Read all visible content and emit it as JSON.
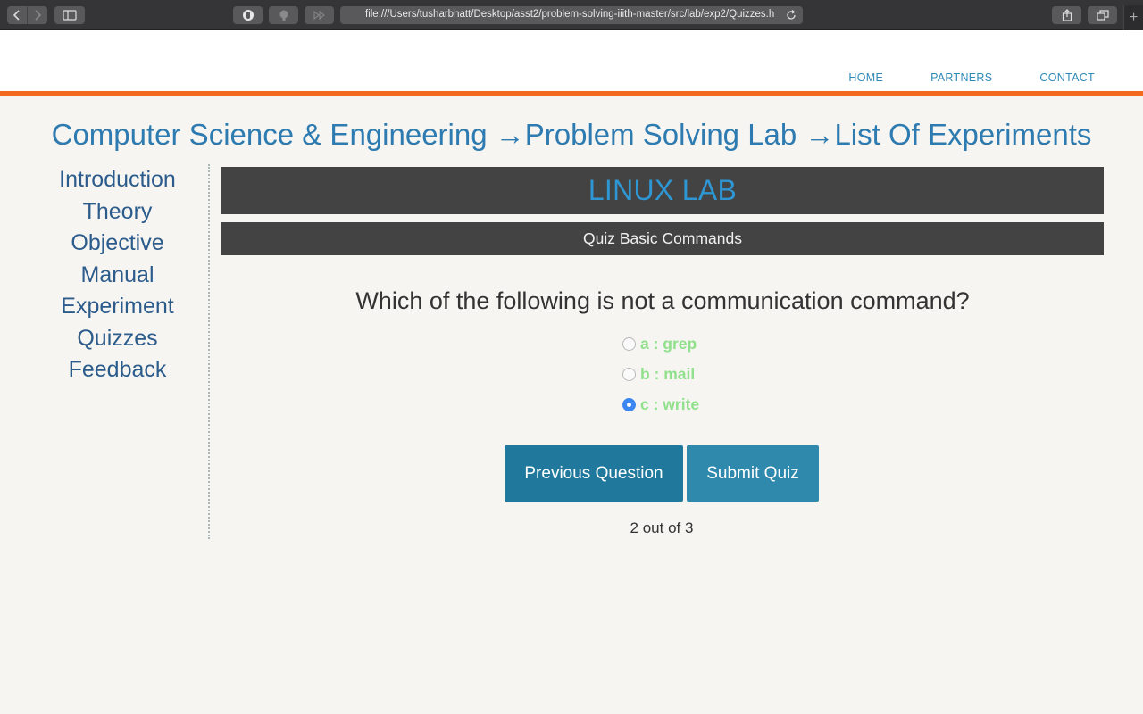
{
  "browser": {
    "url": "file:///Users/tusharbhatt/Desktop/asst2/problem-solving-iiith-master/src/lab/exp2/Quizzes.h"
  },
  "header": {
    "nav": [
      "HOME",
      "PARTNERS",
      "CONTACT"
    ]
  },
  "breadcrumb": {
    "part1": "Computer Science & Engineering",
    "part2": "→Problem Solving Lab",
    "part3": "→List Of Experiments"
  },
  "sidebar": {
    "items": [
      "Introduction",
      "Theory",
      "Objective",
      "Manual",
      "Experiment",
      "Quizzes",
      "Feedback"
    ]
  },
  "main": {
    "lab_title": "LINUX LAB",
    "quiz_title": "Quiz Basic Commands",
    "question": "Which of the following is not a communication command?",
    "options": [
      {
        "label": "a : grep",
        "checked": false
      },
      {
        "label": "b : mail",
        "checked": false
      },
      {
        "label": "c : write",
        "checked": true
      }
    ],
    "prev_button": "Previous Question",
    "submit_button": "Submit Quiz",
    "progress": "2 out of 3"
  },
  "colors": {
    "accent_orange": "#f26b1d",
    "link_blue": "#2d7bb0",
    "option_green": "#90e08c",
    "button_blue": "#20789c"
  }
}
